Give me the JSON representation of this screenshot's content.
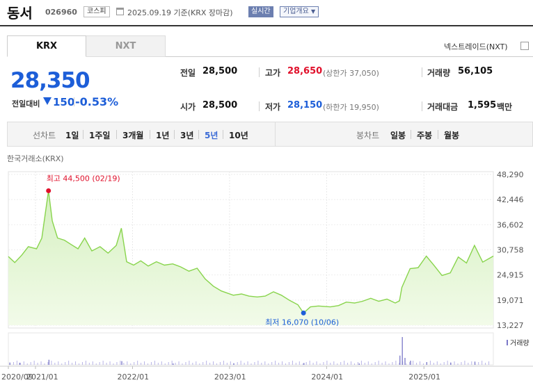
{
  "header": {
    "company": "동서",
    "code": "026960",
    "market": "코스피",
    "date": "2025.09.19",
    "basis": "기준(KRX 장마감)",
    "realtime": "실시간",
    "company_info": "기업개요"
  },
  "tabs": [
    {
      "label": "KRX",
      "active": true
    },
    {
      "label": "NXT",
      "active": false
    }
  ],
  "nxt_trade": "넥스트레이드(NXT)",
  "quote": {
    "price": "28,350",
    "diff_label": "전일대비",
    "diff_value": "150",
    "diff_pct": "-0.53%",
    "direction": "down"
  },
  "stats": {
    "prev_label": "전일",
    "prev_value": "28,500",
    "open_label": "시가",
    "open_value": "28,500",
    "high_label": "고가",
    "high_value": "28,650",
    "upper_limit": "(상한가 37,050)",
    "low_label": "저가",
    "low_value": "28,150",
    "lower_limit": "(하한가 19,950)",
    "volume_label": "거래량",
    "volume_value": "56,105",
    "amount_label": "거래대금",
    "amount_value": "1,595",
    "amount_unit": "백만"
  },
  "periods": {
    "line_label": "선차트",
    "line_items": [
      "1일",
      "1주일",
      "3개월",
      "1년",
      "3년",
      "5년",
      "10년"
    ],
    "active": "5년",
    "candle_label": "봉차트",
    "candle_items": [
      "일봉",
      "주봉",
      "월봉"
    ]
  },
  "chart_source": "한국거래소(KRX)",
  "colors": {
    "accent": "#1d5ed8",
    "up": "#e0102b",
    "line": "#88d44c",
    "area": "#e6f6d8"
  },
  "chart_data": {
    "type": "area",
    "x_tick_labels": [
      "2020/09",
      "2021/01",
      "2022/01",
      "2023/01",
      "2024/01",
      "2025/01"
    ],
    "y_ticks": [
      48290,
      42446,
      36602,
      30758,
      24915,
      19071,
      13227
    ],
    "y_tick_labels": [
      "48,290",
      "42,446",
      "36,602",
      "30,758",
      "24,915",
      "19,071",
      "13,227"
    ],
    "ylim": [
      13227,
      48290
    ],
    "x_range": [
      "2020-09-21",
      "2025-09-19"
    ],
    "high_annotation": {
      "label": "최고 44,500 (02/19)",
      "date": "2021-02-19",
      "value": 44500
    },
    "low_annotation": {
      "label": "최저 16,070 (10/06)",
      "date": "2023-10-06",
      "value": 16070
    },
    "volume_legend": "거래량",
    "series": [
      {
        "dates": [
          "2020-09-21",
          "2020-10-15",
          "2020-11-10",
          "2020-12-05",
          "2021-01-05",
          "2021-01-25",
          "2021-02-19",
          "2021-03-05",
          "2021-03-25",
          "2021-04-20",
          "2021-05-15",
          "2021-06-10",
          "2021-07-05",
          "2021-08-01",
          "2021-09-01",
          "2021-10-01",
          "2021-11-01",
          "2021-11-20",
          "2021-12-10",
          "2022-01-05",
          "2022-02-01",
          "2022-03-01",
          "2022-04-01",
          "2022-05-01",
          "2022-06-01",
          "2022-07-01",
          "2022-08-01",
          "2022-09-01",
          "2022-10-01",
          "2022-11-01",
          "2022-12-01",
          "2023-01-15",
          "2023-02-15",
          "2023-03-15",
          "2023-04-15",
          "2023-05-15",
          "2023-06-15",
          "2023-07-15",
          "2023-08-15",
          "2023-09-15",
          "2023-10-06",
          "2023-11-01",
          "2023-12-01",
          "2024-01-15",
          "2024-02-15",
          "2024-03-15",
          "2024-04-15",
          "2024-05-15",
          "2024-06-15",
          "2024-07-15",
          "2024-08-15",
          "2024-09-15",
          "2024-10-01",
          "2024-10-10",
          "2024-11-10",
          "2024-12-10",
          "2025-01-10",
          "2025-02-10",
          "2025-03-10",
          "2025-04-10",
          "2025-05-10",
          "2025-06-10",
          "2025-07-10",
          "2025-08-10",
          "2025-09-19"
        ],
        "values": [
          29200,
          27800,
          29500,
          31500,
          31000,
          33500,
          44500,
          37500,
          33500,
          33000,
          32000,
          31000,
          33500,
          30500,
          31500,
          30000,
          31800,
          35800,
          28000,
          27200,
          28200,
          27000,
          28000,
          27200,
          27500,
          26800,
          25800,
          26500,
          24000,
          22300,
          21200,
          20200,
          20500,
          20000,
          19800,
          20000,
          21000,
          20200,
          19000,
          18000,
          16070,
          17500,
          17700,
          17500,
          17800,
          18600,
          18400,
          18800,
          19500,
          18800,
          19300,
          18400,
          18900,
          22000,
          26400,
          26600,
          29300,
          27000,
          24800,
          25400,
          29100,
          27700,
          31800,
          27900,
          29300
        ]
      }
    ],
    "volume": {
      "dates": [
        "2020-09-25",
        "2020-11-01",
        "2021-02-19",
        "2021-11-20",
        "2022-06-01",
        "2023-01-15",
        "2023-10-06",
        "2024-05-01",
        "2024-10-01",
        "2024-10-10",
        "2024-10-20",
        "2024-11-10",
        "2025-01-10",
        "2025-04-10",
        "2025-07-10"
      ],
      "values": [
        1.0,
        0.9,
        2.2,
        1.6,
        0.6,
        0.7,
        0.8,
        0.6,
        4.0,
        12.0,
        3.0,
        1.8,
        1.2,
        1.0,
        1.4
      ]
    }
  }
}
